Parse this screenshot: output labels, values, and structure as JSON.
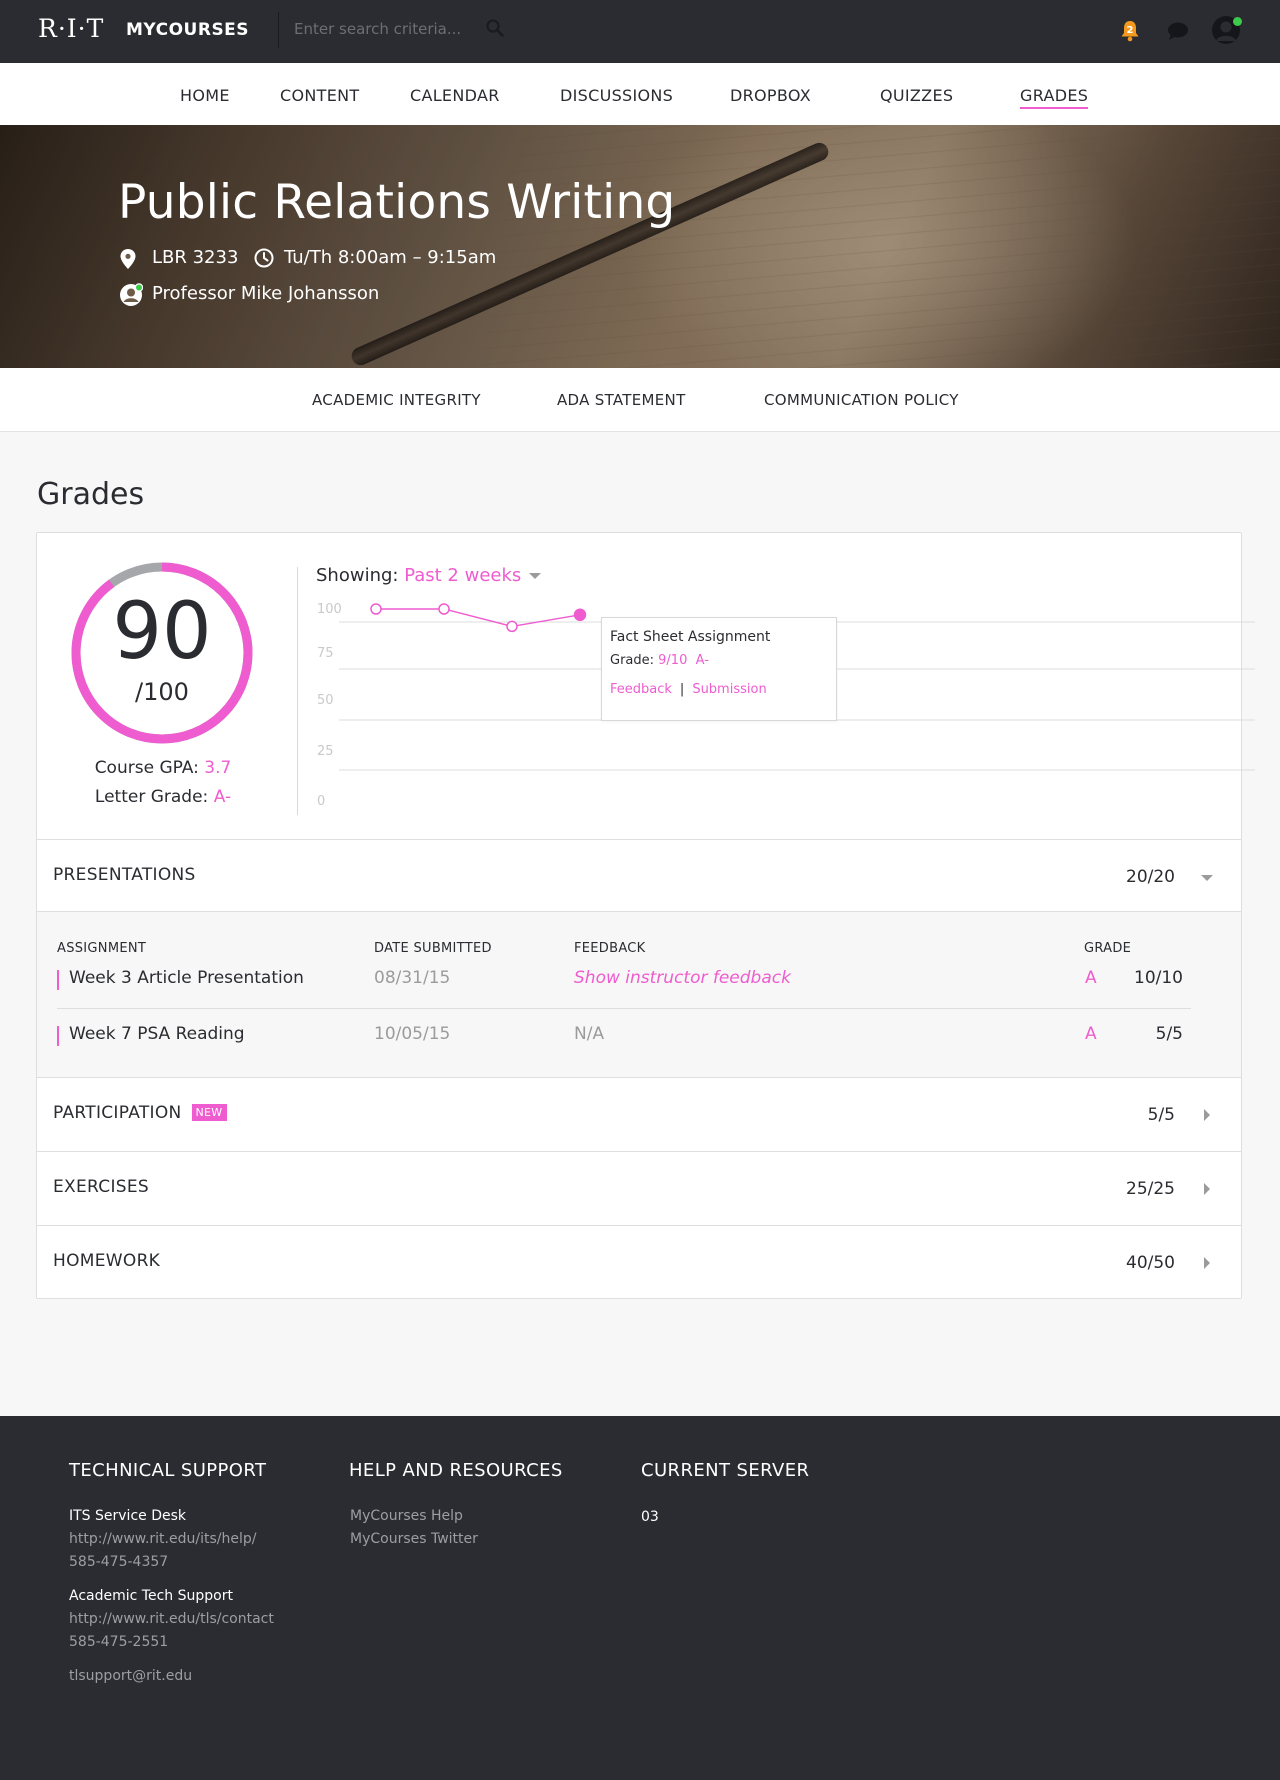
{
  "header": {
    "logo": "R·I·T",
    "brand": "MYCOURSES",
    "search": {
      "placeholder": "Enter search criteria..."
    },
    "notifications": {
      "count": "2"
    },
    "icons": [
      "search-icon",
      "bell-icon",
      "chat-icon",
      "avatar-icon"
    ]
  },
  "main_nav": {
    "items": [
      "HOME",
      "CONTENT",
      "CALENDAR",
      "DISCUSSIONS",
      "DROPBOX",
      "QUIZZES",
      "GRADES"
    ],
    "active": "GRADES"
  },
  "course": {
    "title": "Public Relations Writing",
    "location": "LBR 3233",
    "schedule": "Tu/Th 8:00am – 9:15am",
    "professor": "Professor Mike Johansson"
  },
  "sub_nav": {
    "items": [
      "ACADEMIC INTEGRITY",
      "ADA STATEMENT",
      "COMMUNICATION POLICY"
    ]
  },
  "grades": {
    "title": "Grades",
    "score": "90",
    "score_total": "/100",
    "score_fraction": 0.9,
    "gpa_label": "Course GPA:",
    "gpa": "3.7",
    "letter_label": "Letter Grade:",
    "letter": "A-",
    "showing_label": "Showing:",
    "showing_value": "Past 2 weeks",
    "tooltip": {
      "title": "Fact Sheet Assignment",
      "grade_label": "Grade:",
      "grade_value": "9/10  A-",
      "feedback_link": "Feedback",
      "separator": "|",
      "submission_link": "Submission"
    },
    "categories": [
      {
        "name": "PRESENTATIONS",
        "score": "20/20",
        "expanded": true,
        "badge": ""
      },
      {
        "name": "PARTICIPATION",
        "score": "5/5",
        "expanded": false,
        "badge": "NEW"
      },
      {
        "name": "EXERCISES",
        "score": "25/25",
        "expanded": false,
        "badge": ""
      },
      {
        "name": "HOMEWORK",
        "score": "40/50",
        "expanded": false,
        "badge": ""
      }
    ],
    "assignment_table": {
      "columns": [
        "ASSIGNMENT",
        "DATE SUBMITTED",
        "FEEDBACK",
        "GRADE"
      ],
      "rows": [
        {
          "name": "Week 3 Article Presentation",
          "date": "08/31/15",
          "feedback": "Show instructor feedback",
          "letter": "A",
          "grade": "10/10"
        },
        {
          "name": "Week 7 PSA Reading",
          "date": "10/05/15",
          "feedback": "N/A",
          "letter": "A",
          "grade": "5/5"
        }
      ]
    }
  },
  "chart_data": {
    "type": "line",
    "title": "",
    "xlabel": "",
    "ylabel": "",
    "ylim": [
      0,
      100
    ],
    "yticks": [
      100,
      75,
      50,
      25,
      0
    ],
    "x": [
      1,
      2,
      3,
      4
    ],
    "series": [
      {
        "values": [
          100,
          100,
          94,
          98
        ],
        "highlight_index": 3
      }
    ],
    "grid": true,
    "color": "#ee5ccf"
  },
  "footer": {
    "technical_support": {
      "heading": "TECHNICAL SUPPORT",
      "its_name": "ITS Service Desk",
      "its_url": "http://www.rit.edu/its/help/",
      "its_phone": "585-475-4357",
      "ats_name": "Academic Tech Support",
      "ats_url": "http://www.rit.edu/tls/contact",
      "ats_phone": "585-475-2551",
      "email": "tlsupport@rit.edu"
    },
    "help": {
      "heading": "HELP AND RESOURCES",
      "links": [
        "MyCourses Help",
        "MyCourses Twitter"
      ]
    },
    "server": {
      "heading": "CURRENT SERVER",
      "value": "03"
    }
  },
  "colors": {
    "accent": "#ee5ccf",
    "dark": "#2b2c31",
    "notification": "#f39a1e",
    "online": "#3dc94a",
    "ring_track": "#a5a7ab"
  }
}
